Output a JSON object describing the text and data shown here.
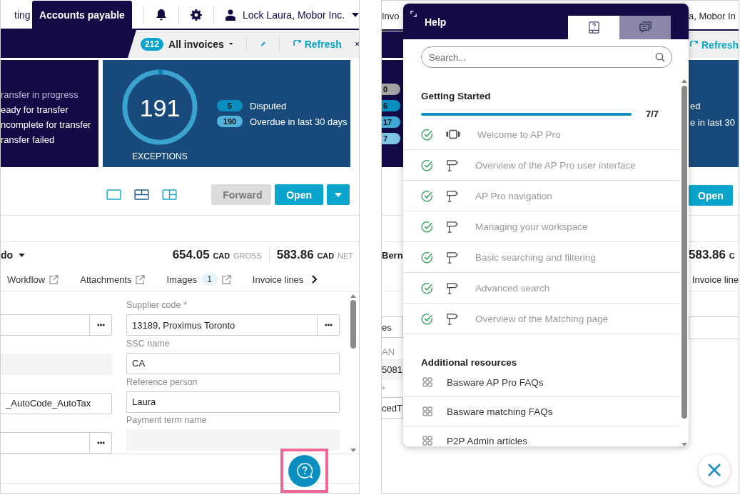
{
  "left_screen": {
    "top_tabs": [
      {
        "label": "ting",
        "selected": false
      },
      {
        "label": "Accounts payable",
        "selected": true
      }
    ],
    "user": "Lock Laura, Mobor Inc.",
    "view": {
      "count": "212",
      "name": "All invoices",
      "refresh": "Refresh"
    },
    "status_list": [
      {
        "label": "ransfer in progress",
        "dimmed": true
      },
      {
        "label": "eady for transfer",
        "dimmed": false
      },
      {
        "label": "ncomplete for transfer",
        "dimmed": false
      },
      {
        "label": "ransfer failed",
        "dimmed": false
      }
    ],
    "exceptions": {
      "count": "191",
      "label": "EXCEPTIONS"
    },
    "exception_badges": [
      {
        "count": "5",
        "label": "Disputed",
        "color": "#0b8fc1"
      },
      {
        "count": "190",
        "label": "Overdue in last 30 days",
        "color": "#52b4dc"
      }
    ],
    "actions": [
      {
        "label": "Forward",
        "disabled": true
      },
      {
        "label": "Open",
        "disabled": false
      }
    ],
    "supplier": "do",
    "totals": [
      {
        "amount": "654.05",
        "currency": "CAD",
        "type": "GROSS"
      },
      {
        "amount": "583.86",
        "currency": "CAD",
        "type": "NET"
      }
    ],
    "detail_tabs": [
      {
        "label": "Workflow",
        "external": true
      },
      {
        "label": "Attachments",
        "external": true
      },
      {
        "label": "Images",
        "count": "1",
        "external": true
      },
      {
        "label": "Invoice lines",
        "external": false
      }
    ],
    "form_left": [
      {
        "kind": "lookup"
      },
      {
        "kind": "readonly"
      },
      {
        "kind": "text",
        "value": "_AutoCode_AutoTax"
      },
      {
        "kind": "lookup"
      }
    ],
    "form_right": [
      {
        "label": "Supplier code *",
        "kind": "lookup",
        "value": "13189, Proximus Toronto"
      },
      {
        "label": "SSC name",
        "kind": "text",
        "value": "CA"
      },
      {
        "label": "Reference person",
        "kind": "text",
        "value": "Laura"
      },
      {
        "label": "Payment term name",
        "kind": "readonly"
      }
    ]
  },
  "right_screen": {
    "background": {
      "top_left": "Invo",
      "top_right": "a, Mobor In",
      "refresh": "Refresh",
      "badges": [
        {
          "count": "0",
          "color": "#a3a3a3"
        },
        {
          "count": "6",
          "color": "#0b8fc1"
        },
        {
          "count": "17",
          "color": "#3ea8d6"
        },
        {
          "count": "7",
          "color": "#7dc5e5"
        }
      ],
      "card_texts": [
        "ed",
        "e in last 30"
      ],
      "open": "Open",
      "supplier": "Bern",
      "net_amount": "583.86",
      "net_currency": "C",
      "tab": "Invoice line",
      "left_texts": [
        "es",
        "AN",
        "5081",
        "*",
        "cedT"
      ]
    },
    "help": {
      "title": "Help",
      "tabs": [
        {
          "kind": "guides",
          "selected": true
        },
        {
          "kind": "chat",
          "selected": false
        }
      ],
      "search": {
        "placeholder": "Search..."
      },
      "getting_started": {
        "title": "Getting Started",
        "level": 1,
        "reading": "7/7",
        "items": [
          {
            "label": "Welcome to AP Pro",
            "kind": "tour",
            "done": true
          },
          {
            "label": "Overview of the AP Pro user interface",
            "kind": "guide",
            "done": true
          },
          {
            "label": "AP Pro navigation",
            "kind": "guide",
            "done": true
          },
          {
            "label": "Managing your workspace",
            "kind": "guide",
            "done": true
          },
          {
            "label": "Basic searching and filtering",
            "kind": "guide",
            "done": true
          },
          {
            "label": "Advanced search",
            "kind": "guide",
            "done": true
          },
          {
            "label": "Overview of the Matching page",
            "kind": "guide",
            "done": true
          }
        ]
      },
      "resources": {
        "title": "Additional resources",
        "items": [
          "Basware AP Pro FAQs",
          "Basware matching FAQs",
          "P2P Admin articles"
        ]
      }
    }
  }
}
